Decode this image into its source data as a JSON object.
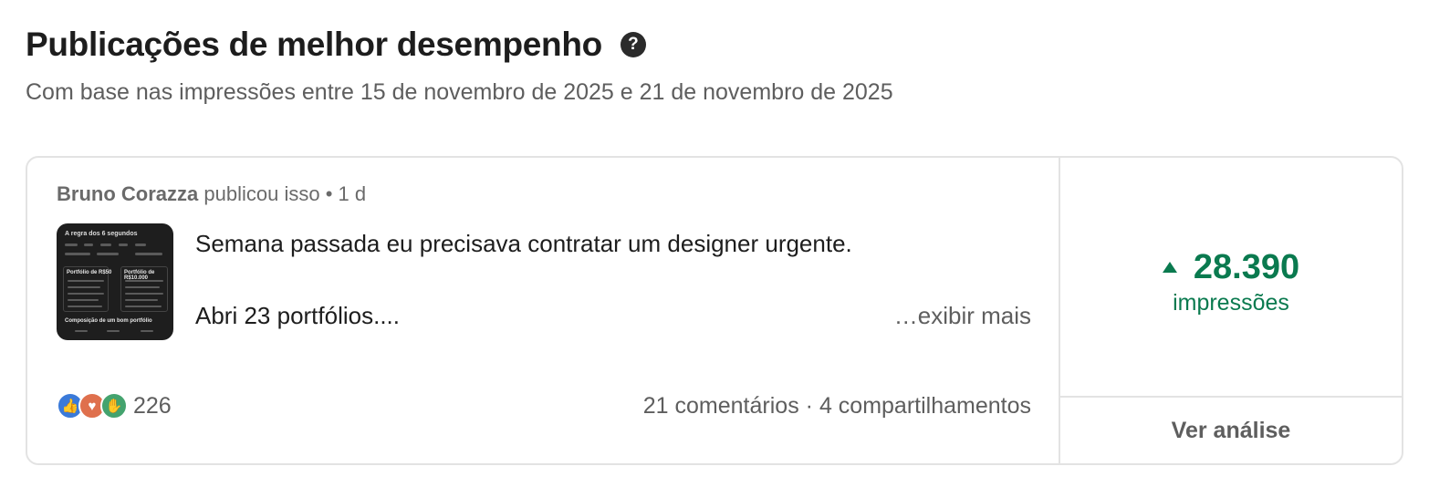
{
  "header": {
    "title": "Publicações de melhor desempenho",
    "help_icon": "?",
    "subtitle": "Com base nas impressões entre 15 de novembro de 2025 e 21 de novembro de 2025"
  },
  "post": {
    "author": "Bruno Corazza",
    "action": "publicou isso",
    "separator": "•",
    "time": "1 d",
    "text_line1": "Semana passada eu precisava contratar um designer urgente.",
    "text_line2": "Abri 23 portfólios....",
    "show_more": "…exibir mais",
    "thumbnail": {
      "title": "A regra dos 6 segundos",
      "col1": "Portfólio de R$50",
      "col2": "Portfólio de R$10.000",
      "footer": "Composição de um bom portfólio"
    },
    "reactions": {
      "icons": [
        "like-icon",
        "love-icon",
        "support-icon"
      ],
      "count": "226"
    },
    "comments": "21 comentários",
    "dot": "·",
    "shares": "4 compartilhamentos"
  },
  "metric": {
    "trend_icon": "up-arrow-icon",
    "value": "28.390",
    "label": "impressões",
    "color": "#0a7a4f"
  },
  "analysis_button": "Ver análise"
}
